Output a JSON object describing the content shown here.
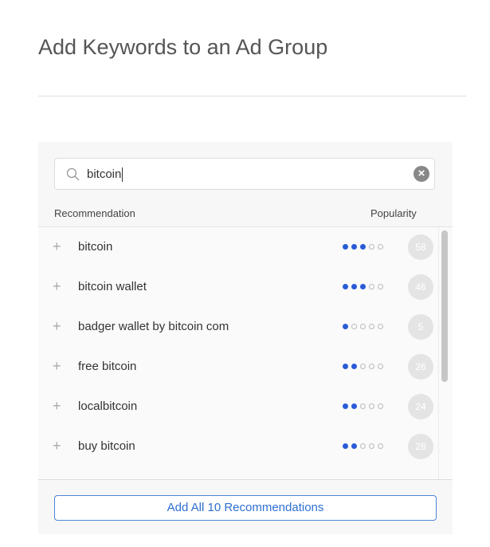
{
  "page_title": "Add Keywords to an Ad Group",
  "search": {
    "value": "bitcoin",
    "clear_icon": "clear-circle-icon",
    "search_icon": "magnifier-icon"
  },
  "columns": {
    "recommendation": "Recommendation",
    "popularity": "Popularity"
  },
  "accent_color": "#2a5bd7",
  "recommendations": [
    {
      "keyword": "bitcoin",
      "popularity_dots": 3,
      "popularity_max": 5,
      "score": "58"
    },
    {
      "keyword": "bitcoin wallet",
      "popularity_dots": 3,
      "popularity_max": 5,
      "score": "46"
    },
    {
      "keyword": "badger wallet by bitcoin com",
      "popularity_dots": 1,
      "popularity_max": 5,
      "score": "5"
    },
    {
      "keyword": "free bitcoin",
      "popularity_dots": 2,
      "popularity_max": 5,
      "score": "26"
    },
    {
      "keyword": "localbitcoin",
      "popularity_dots": 2,
      "popularity_max": 5,
      "score": "24"
    },
    {
      "keyword": "buy bitcoin",
      "popularity_dots": 2,
      "popularity_max": 5,
      "score": "28"
    }
  ],
  "add_all_label": "Add All 10 Recommendations"
}
